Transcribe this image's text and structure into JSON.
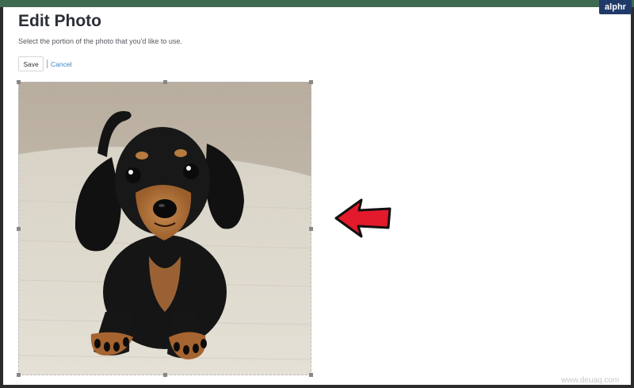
{
  "page": {
    "title": "Edit Photo",
    "subtitle": "Select the portion of the photo that you'd like to use."
  },
  "actions": {
    "save_label": "Save",
    "cancel_label": "Cancel"
  },
  "brand": {
    "logo_text": "alphr",
    "watermark": "www.deuaq.com"
  },
  "colors": {
    "topbar_green": "#3f6a52",
    "link_blue": "#3c86c3",
    "arrow_red": "#e3192c",
    "brand_navy": "#1f3a68"
  },
  "icons": {
    "arrow": "arrow-left-icon"
  }
}
